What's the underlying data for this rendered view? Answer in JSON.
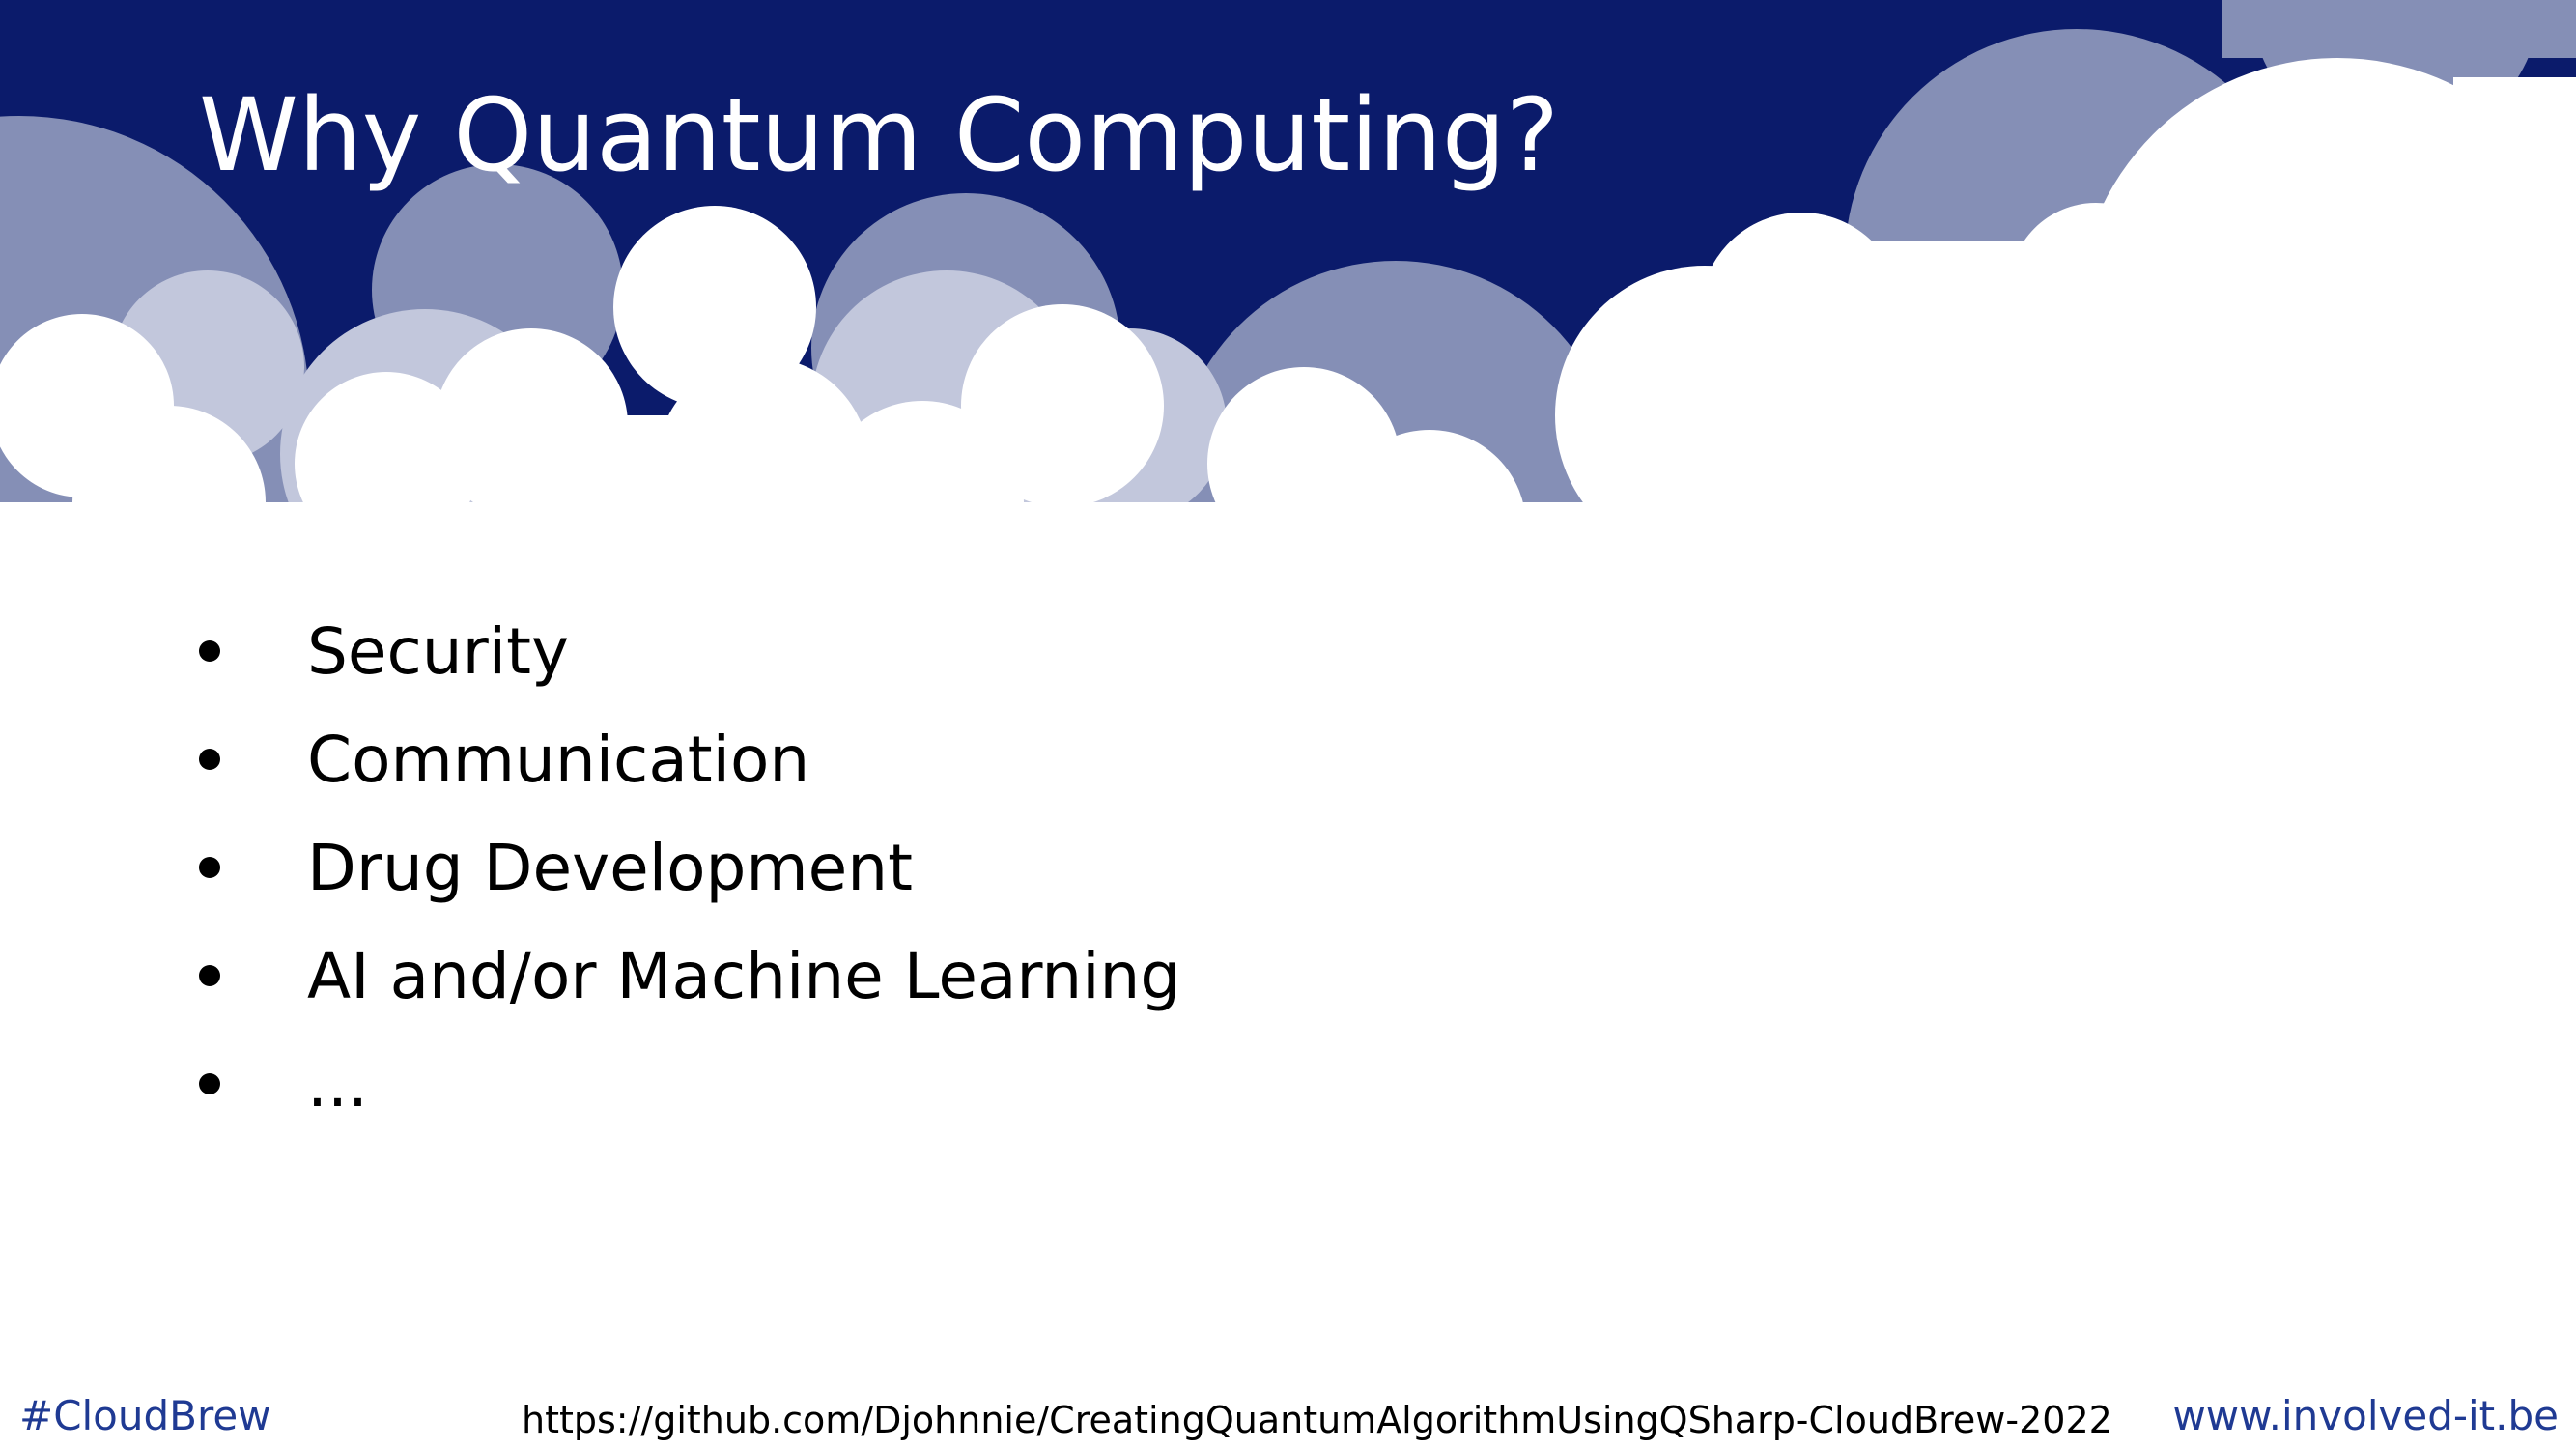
{
  "slide": {
    "title": "Why Quantum Computing?",
    "bullets": [
      "Security",
      "Communication",
      "Drug Development",
      "AI and/or Machine Learning",
      "..."
    ]
  },
  "footer": {
    "hashtag": "#CloudBrew",
    "repo_url": "https://github.com/Djohnnie/CreatingQuantumAlgorithmUsingQSharp-CloudBrew-2022",
    "website": "www.involved-it.be"
  },
  "colors": {
    "header_navy": "#0b1b6b",
    "cloud_mid": "#858fb6",
    "cloud_light": "#c2c7dc",
    "cloud_white": "#ffffff",
    "footer_blue": "#1f3a93"
  }
}
